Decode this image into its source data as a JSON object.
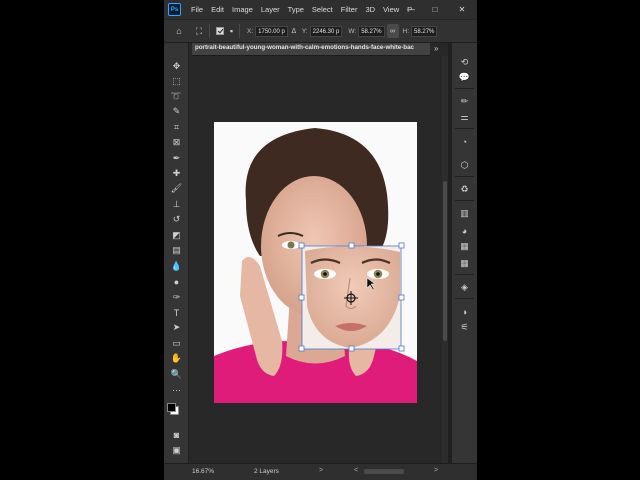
{
  "app": {
    "logo": "Ps"
  },
  "menu": {
    "items": [
      "File",
      "Edit",
      "Image",
      "Layer",
      "Type",
      "Select",
      "Filter",
      "3D",
      "View",
      "P"
    ]
  },
  "window_controls": {
    "minimize": "—",
    "maximize": "□",
    "close": "✕"
  },
  "options_bar": {
    "x_label": "X:",
    "x_value": "1750.00 p",
    "y_label": "Y:",
    "y_value": "2246.30 p",
    "w_label": "W:",
    "w_value": "58.27%",
    "h_label": "H:",
    "h_value": "58.27%"
  },
  "document": {
    "tab_title": "portrait-beautiful-young-woman-with-calm-emotions-hands-face-white-bac",
    "tab_more": "»"
  },
  "status_bar": {
    "zoom": "16.67%",
    "layers": "2 Layers",
    "prev": "<",
    "next": ">"
  },
  "colors": {
    "background": "#282828",
    "panel": "#353535",
    "accent": "#31a8ff",
    "shirt": "#e01c7a",
    "selection": "#4a7ad0"
  },
  "icons": {
    "toolbar": [
      "move-icon",
      "marquee-icon",
      "lasso-icon",
      "quick-select-icon",
      "crop-icon",
      "frame-icon",
      "eyedropper-icon",
      "healing-icon",
      "brush-icon",
      "clone-stamp-icon",
      "history-brush-icon",
      "eraser-icon",
      "gradient-icon",
      "blur-icon",
      "dodge-icon",
      "pen-icon",
      "type-icon",
      "path-select-icon",
      "rectangle-icon",
      "hand-icon",
      "zoom-icon",
      "more-tools-icon"
    ],
    "right_panel": [
      "history-icon",
      "comments-icon",
      "brush-settings-icon",
      "adjust-icon",
      "channels-icon",
      "3d-icon",
      "libraries-icon",
      "swatches-icon",
      "color-icon",
      "patterns-icon",
      "grid-icon",
      "layers-icon",
      "adjustments-icon",
      "properties-icon"
    ]
  }
}
